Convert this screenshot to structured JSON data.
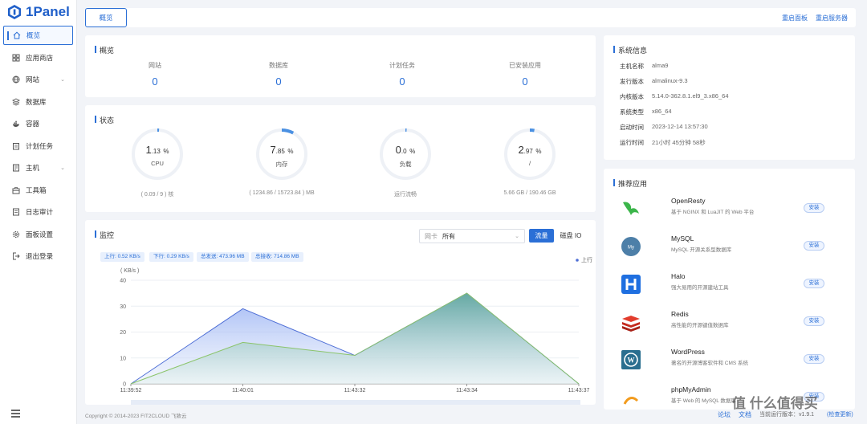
{
  "app": {
    "name": "1Panel"
  },
  "sidebar": {
    "items": [
      {
        "label": "概览",
        "icon": "home-icon"
      },
      {
        "label": "应用商店",
        "icon": "grid-icon"
      },
      {
        "label": "网站",
        "icon": "globe-icon"
      },
      {
        "label": "数据库",
        "icon": "database-icon"
      },
      {
        "label": "容器",
        "icon": "container-icon"
      },
      {
        "label": "计划任务",
        "icon": "calendar-icon"
      },
      {
        "label": "主机",
        "icon": "host-icon"
      },
      {
        "label": "工具箱",
        "icon": "toolbox-icon"
      },
      {
        "label": "日志审计",
        "icon": "log-icon"
      },
      {
        "label": "面板设置",
        "icon": "settings-icon"
      },
      {
        "label": "退出登录",
        "icon": "logout-icon"
      }
    ]
  },
  "topbar": {
    "tab": "概览",
    "restart_panel": "重启面板",
    "restart_server": "重启服务器"
  },
  "overview": {
    "title": "概览",
    "items": [
      {
        "label": "网站",
        "value": "0"
      },
      {
        "label": "数据库",
        "value": "0"
      },
      {
        "label": "计划任务",
        "value": "0"
      },
      {
        "label": "已安装应用",
        "value": "0"
      }
    ]
  },
  "status": {
    "title": "状态",
    "gauges": [
      {
        "int": "1",
        "dec": ".13",
        "unit": "%",
        "label": "CPU",
        "foot": "( 0.09 / 9 ) 核",
        "percent": 1.13
      },
      {
        "int": "7",
        "dec": ".85",
        "unit": "%",
        "label": "内存",
        "foot": "( 1234.86 / 15723.84 ) MB",
        "percent": 7.85
      },
      {
        "int": "0",
        "dec": ".0",
        "unit": "%",
        "label": "负载",
        "foot": "运行流畅",
        "percent": 0
      },
      {
        "int": "2",
        "dec": ".97",
        "unit": "%",
        "label": "/",
        "foot": "5.66 GB / 190.46 GB",
        "percent": 2.97
      }
    ]
  },
  "monitor": {
    "title": "监控",
    "select_prefix": "网卡",
    "select_value": "所有",
    "btn_flow": "流量",
    "btn_io": "磁盘 IO",
    "chips": [
      "上行: 0.52 KB/s",
      "下行: 0.29 KB/s",
      "总发送: 473.96 MB",
      "总接收: 714.86 MB"
    ],
    "legend": "上行"
  },
  "chart_data": {
    "type": "area",
    "ylabel": "( KB/s )",
    "ylim": [
      0,
      40
    ],
    "yticks": [
      "0",
      "10",
      "20",
      "30",
      "40"
    ],
    "categories": [
      "11:39:52",
      "11:40:01",
      "11:43:32",
      "11:43:34",
      "11:43:37"
    ],
    "series": [
      {
        "name": "上行",
        "values": [
          0,
          29,
          11,
          35,
          0
        ],
        "color": "#4f6fd6"
      },
      {
        "name": "",
        "values": [
          0,
          16,
          11,
          35,
          0
        ],
        "color": "#8bc46a"
      }
    ]
  },
  "sysinfo": {
    "title": "系统信息",
    "rows": [
      {
        "k": "主机名称",
        "v": "alma9"
      },
      {
        "k": "发行版本",
        "v": "almalinux-9.3"
      },
      {
        "k": "内核版本",
        "v": "5.14.0-362.8.1.el9_3.x86_64"
      },
      {
        "k": "系统类型",
        "v": "x86_64"
      },
      {
        "k": "启动时间",
        "v": "2023-12-14 13:57:30"
      },
      {
        "k": "运行时间",
        "v": "21小时 45分钟 58秒"
      }
    ]
  },
  "apps": {
    "title": "推荐应用",
    "install_label": "安装",
    "items": [
      {
        "name": "OpenResty",
        "desc": "基于 NGINX 和 LuaJIT 的 Web 平台",
        "icon": "openresty-icon"
      },
      {
        "name": "MySQL",
        "desc": "MySQL 开源关系型数据库",
        "icon": "mysql-icon"
      },
      {
        "name": "Halo",
        "desc": "强大易用的开源建站工具",
        "icon": "halo-icon"
      },
      {
        "name": "Redis",
        "desc": "高性能的开源键值数据库",
        "icon": "redis-icon"
      },
      {
        "name": "WordPress",
        "desc": "著名的开源博客软件和 CMS 系统",
        "icon": "wordpress-icon"
      },
      {
        "name": "phpMyAdmin",
        "desc": "基于 Web 的 MySQL 数据库",
        "icon": "phpmyadmin-icon"
      }
    ]
  },
  "footer": {
    "copyright": "Copyright © 2014-2023 FIT2CLOUD 飞致云",
    "forum": "论坛",
    "docs": "文档",
    "version": "当前运行版本：v1.9.1",
    "check_update": "(检查更新)"
  },
  "watermark": "值 什么值得买"
}
